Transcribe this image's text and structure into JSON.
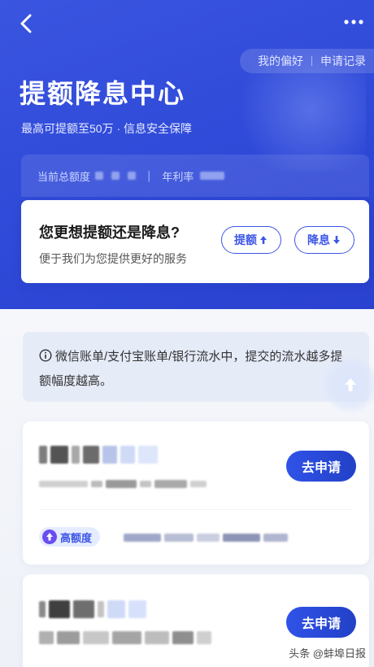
{
  "header": {
    "back_icon": "chevron-left-icon",
    "more_icon": "more-horizontal-icon",
    "pills": [
      "我的偏好",
      "申请记录"
    ],
    "title": "提额降息中心",
    "subtitle": "最高可提额至50万 · 信息安全保障"
  },
  "rate_band": {
    "total_label": "当前总额度",
    "rate_label": "年利率"
  },
  "choice_card": {
    "title": "您更想提额还是降息?",
    "description": "便于我们为您提供更好的服务",
    "raise_label": "提额",
    "lower_label": "降息",
    "raise_icon": "arrow-up-icon",
    "lower_icon": "arrow-down-icon"
  },
  "tip": {
    "icon": "info-circle-icon",
    "text": "微信账单/支付宝账单/银行流水中，提交的流水越多提额幅度越高。"
  },
  "cards": [
    {
      "apply_label": "去申请",
      "tag_label": "高额度"
    },
    {
      "apply_label": "去申请"
    }
  ],
  "watermark": "头条 @蚌埠日报",
  "colors": {
    "hero_blue": "#3049d9",
    "accent_blue": "#3d56e6",
    "button_blue": "#2a48d6",
    "tip_bg": "#e6ebf8"
  }
}
